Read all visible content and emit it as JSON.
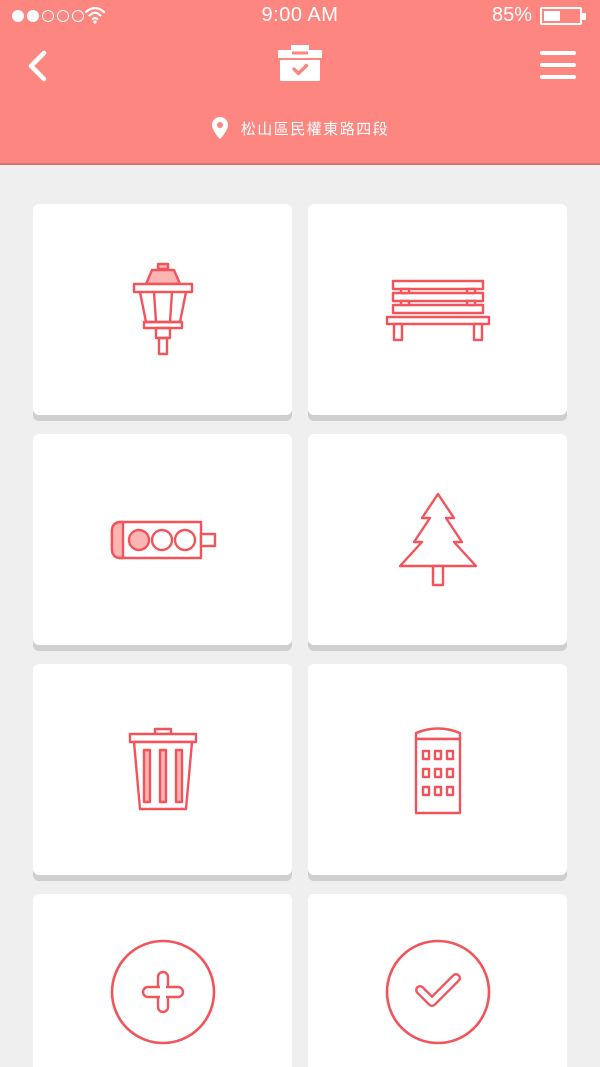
{
  "colors": {
    "accent": "#fe8680",
    "icon_stroke": "#f2545b",
    "icon_fill": "#fbb5b2",
    "background": "#efefef"
  },
  "status_bar": {
    "time": "9:00  AM",
    "battery": "85%",
    "battery_level": 0.85,
    "signal_bars_filled": 2,
    "signal_bars_total": 5
  },
  "header": {
    "back_icon": "chevron-left-icon",
    "logo_icon": "ballot-box-check-icon",
    "menu_icon": "hamburger-menu-icon",
    "location": {
      "icon": "map-pin-icon",
      "label": "松山區民權東路四段"
    }
  },
  "tiles": [
    {
      "icon": "street-lamp-icon"
    },
    {
      "icon": "park-bench-icon"
    },
    {
      "icon": "traffic-light-icon"
    },
    {
      "icon": "pine-tree-icon"
    },
    {
      "icon": "trash-can-icon"
    },
    {
      "icon": "building-icon"
    },
    {
      "icon": "plus-circle-icon"
    },
    {
      "icon": "check-circle-icon"
    }
  ]
}
